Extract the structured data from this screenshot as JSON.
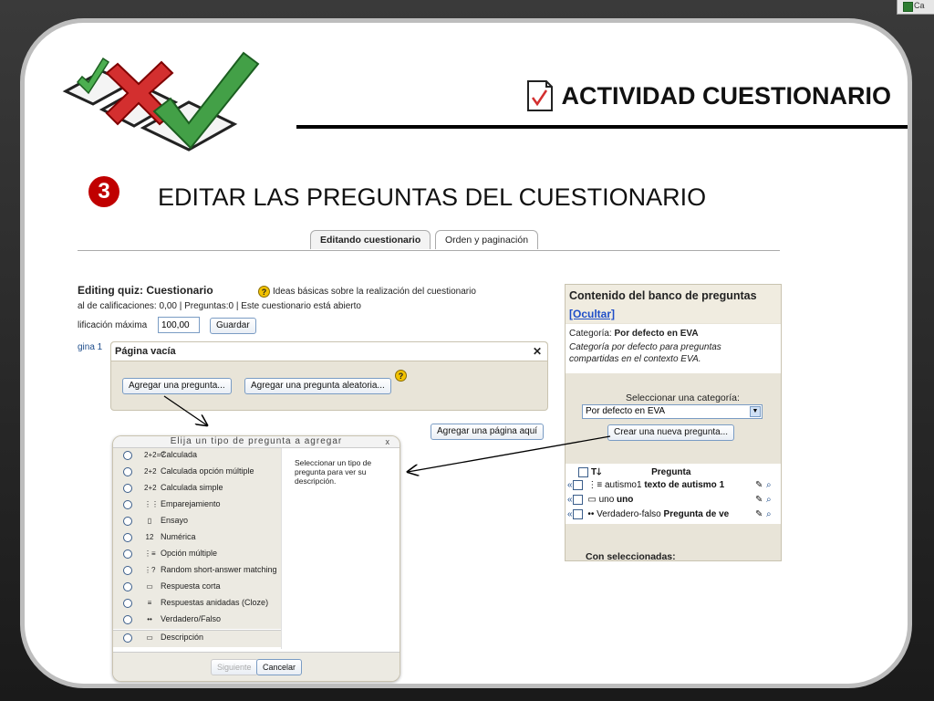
{
  "corner": {
    "text": "Ca"
  },
  "slide": {
    "title": "ACTIVIDAD CUESTIONARIO",
    "step_number": "3",
    "step_title": "EDITAR LAS PREGUNTAS DEL CUESTIONARIO"
  },
  "tabs": [
    {
      "label": "Editando cuestionario"
    },
    {
      "label": "Orden y paginación"
    }
  ],
  "quiz": {
    "heading": "Editing quiz: Cuestionario",
    "help_link": "Ideas básicas sobre la realización del cuestionario",
    "summary": "al de calificaciones: 0,00 | Preguntas:0 | Este cuestionario está abierto",
    "maxgrade_label": "lificación máxima",
    "maxgrade_value": "100,00",
    "save_button": "Guardar",
    "page_label": "gina 1",
    "empty_page_title": "Página vacía",
    "close_symbol": "✕",
    "add_question_button": "Agregar una pregunta...",
    "add_random_button": "Agregar una pregunta aleatoria...",
    "add_page_button": "Agregar una página aquí"
  },
  "chooser": {
    "title": "Elija un tipo de pregunta a agregar",
    "close_symbol": "x",
    "options": [
      {
        "label": "Calculada",
        "icon": "2+2=?"
      },
      {
        "label": "Calculada opción múltiple",
        "icon": "2+2"
      },
      {
        "label": "Calculada simple",
        "icon": "2+2"
      },
      {
        "label": "Emparejamiento",
        "icon": "⋮⋮"
      },
      {
        "label": "Ensayo",
        "icon": "▯"
      },
      {
        "label": "Numérica",
        "icon": "12"
      },
      {
        "label": "Opción múltiple",
        "icon": "⋮≡"
      },
      {
        "label": "Random short-answer matching",
        "icon": "⋮?"
      },
      {
        "label": "Respuesta corta",
        "icon": "▭"
      },
      {
        "label": "Respuestas anidadas (Cloze)",
        "icon": "≡"
      },
      {
        "label": "Verdadero/Falso",
        "icon": "••"
      },
      {
        "label": "Descripción",
        "icon": "▭"
      }
    ],
    "description": "Seleccionar un tipo de pregunta para ver su descripción.",
    "next_button": "Siguiente",
    "cancel_button": "Cancelar"
  },
  "bank": {
    "title": "Contenido del banco de preguntas",
    "hide_link": "[Ocultar]",
    "category_prefix": "Categoría:",
    "category_name": "Por defecto en EVA",
    "category_desc": "Categoría por defecto para preguntas compartidas en el contexto EVA.",
    "select_label": "Seleccionar una categoría:",
    "select_value": "Por defecto en EVA",
    "create_button": "Crear una nueva pregunta...",
    "col_type": "T",
    "col_question": "Pregunta",
    "rows": [
      {
        "name": "autismo1",
        "text": "texto de autismo 1"
      },
      {
        "name": "uno",
        "text": "uno"
      },
      {
        "name": "Verdadero-falso",
        "text": "Pregunta de ve"
      }
    ],
    "with_selected": "Con seleccionadas:"
  }
}
